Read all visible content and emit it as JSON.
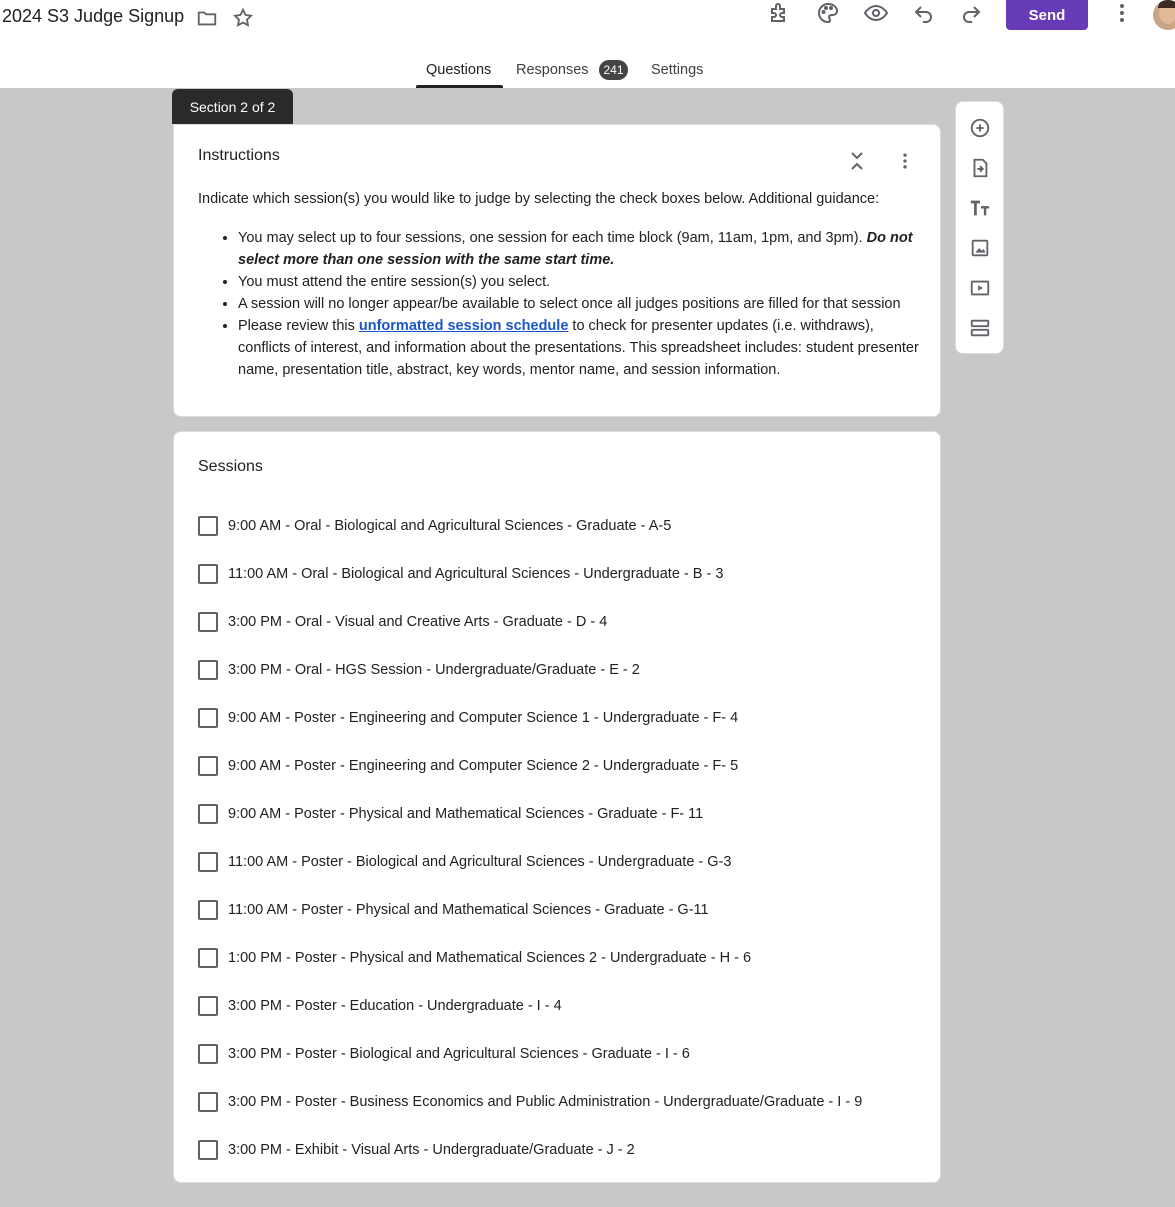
{
  "header": {
    "title": "2024 S3 Judge Signup",
    "send_label": "Send",
    "icons": [
      "folder-icon",
      "star-icon",
      "addon-icon",
      "palette-icon",
      "preview-eye-icon",
      "undo-icon",
      "redo-icon",
      "more-vert-icon"
    ]
  },
  "tabs": [
    {
      "label": "Questions",
      "active": true
    },
    {
      "label": "Responses",
      "badge": "241"
    },
    {
      "label": "Settings"
    }
  ],
  "section": {
    "label": "Section 2 of 2"
  },
  "instructions": {
    "title": "Instructions",
    "intro": "Indicate which session(s) you would like to judge by selecting the check boxes below. Additional guidance:",
    "bullet1_text": "You may select up to four sessions, one session for each time block (9am, 11am, 1pm, and 3pm). ",
    "bullet1_emphasis": "Do not select more than one session with the same start time.",
    "bullet2": "You must attend the entire session(s) you select.",
    "bullet3": "A session will no longer appear/be available to select once all judges positions are filled for that session",
    "bullet4_before": "Please review this ",
    "bullet4_link": "unformatted session schedule",
    "bullet4_after": " to check for presenter updates (i.e. withdraws), conflicts of interest, and information about the presentations. This spreadsheet includes: student presenter name, presentation title, abstract, key words, mentor name, and session information."
  },
  "sessions": {
    "title": "Sessions",
    "options": [
      "9:00 AM - Oral - Biological and Agricultural Sciences - Graduate - A-5",
      "11:00 AM - Oral - Biological and Agricultural Sciences - Undergraduate - B - 3",
      "3:00 PM - Oral - Visual and Creative Arts - Graduate - D - 4",
      "3:00 PM - Oral - HGS Session - Undergraduate/Graduate - E - 2",
      "9:00 AM - Poster - Engineering and Computer Science 1 - Undergraduate - F- 4",
      "9:00 AM - Poster - Engineering and Computer Science 2 - Undergraduate - F- 5",
      "9:00 AM - Poster - Physical and Mathematical Sciences - Graduate - F- 11",
      "11:00 AM - Poster - Biological and Agricultural Sciences - Undergraduate - G-3",
      "11:00 AM - Poster - Physical and Mathematical Sciences - Graduate - G-11",
      "1:00 PM - Poster - Physical and Mathematical Sciences 2 - Undergraduate - H - 6",
      "3:00 PM - Poster - Education - Undergraduate - I - 4",
      "3:00 PM - Poster - Biological and Agricultural Sciences - Graduate - I - 6",
      "3:00 PM - Poster - Business Economics and Public Administration - Undergraduate/Graduate - I - 9",
      "3:00 PM - Exhibit - Visual Arts - Undergraduate/Graduate - J - 2"
    ]
  },
  "side_toolbar": [
    "add-question-icon",
    "import-questions-icon",
    "add-title-icon",
    "add-image-icon",
    "add-video-icon",
    "add-section-icon"
  ],
  "colors": {
    "accent": "#673ab7",
    "link": "#1a57c6",
    "background": "#c8c8c8"
  }
}
